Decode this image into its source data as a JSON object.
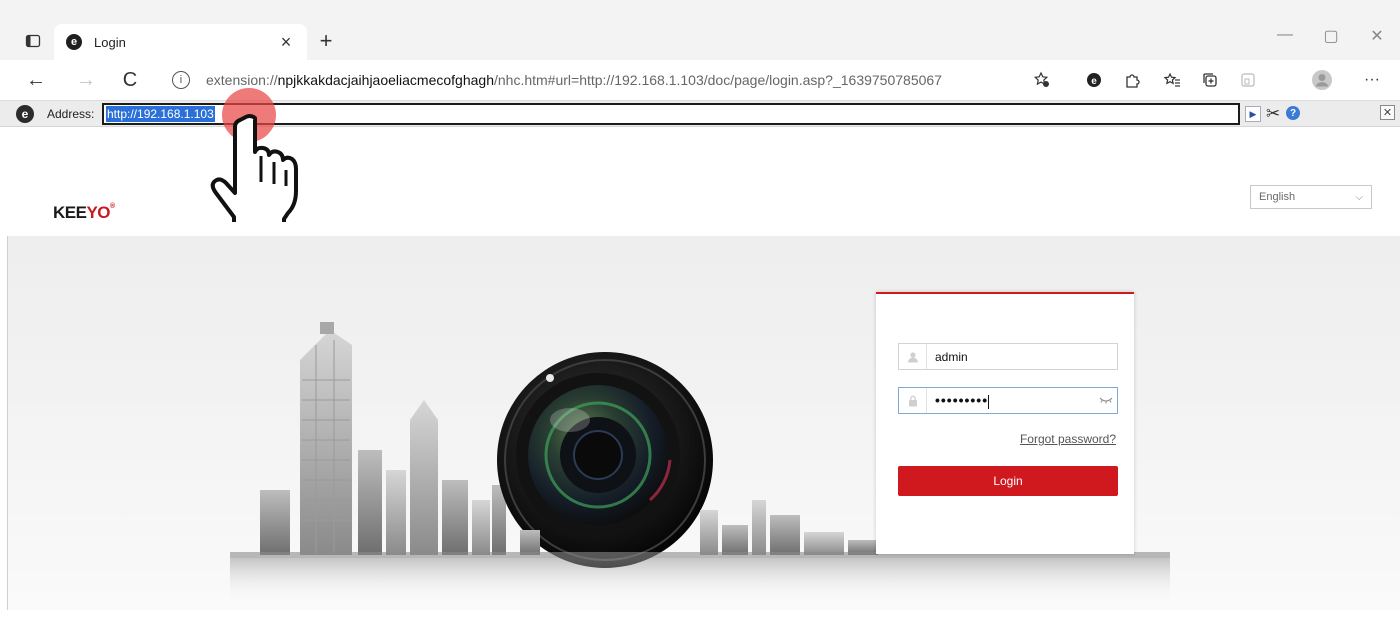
{
  "browser": {
    "tab": {
      "title": "Login",
      "favicon": "ietab-favicon",
      "close": "×"
    },
    "new_tab": "+",
    "window_controls": {
      "minimize": "—",
      "maximize": "▢",
      "close": "✕"
    },
    "nav": {
      "back": "←",
      "forward": "→",
      "refresh": "C"
    },
    "omnibox": {
      "info": "i",
      "url_prefix": "extension://",
      "url_host": "npjkkakdacjaihjaoeliacmecofghagh",
      "url_rest": "/nhc.htm#url=http://192.168.1.103/doc/page/login.asp?_1639750785067"
    },
    "more": "···"
  },
  "ietab": {
    "logo": "e",
    "address_label": "Address:",
    "address_value": "http://192.168.1.103",
    "go": "▶",
    "tools": "✂",
    "help": "?",
    "close": "✕"
  },
  "page": {
    "brand": {
      "part1": "KEE",
      "part2": "YO",
      "mark": "®"
    },
    "language": {
      "selected": "English",
      "chevron": "⌵"
    },
    "login": {
      "username": "admin",
      "password_mask": "•••••••••",
      "forgot": "Forgot password?",
      "button": "Login"
    }
  },
  "colors": {
    "accent_red": "#d0191f",
    "selection_blue": "#2a70d8",
    "click_indicator": "#e84646"
  }
}
